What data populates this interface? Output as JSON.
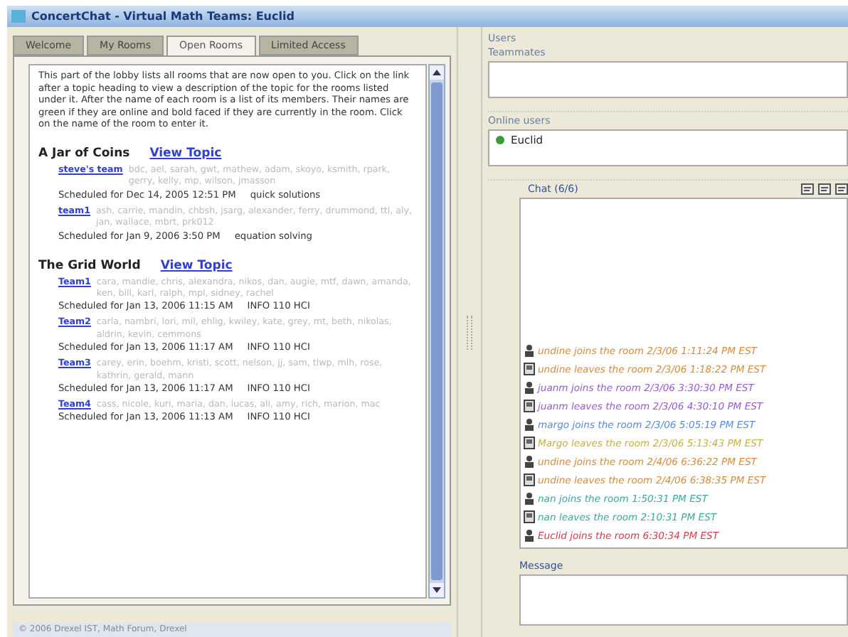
{
  "window": {
    "title": "ConcertChat - Virtual Math Teams: Euclid"
  },
  "tabs": [
    {
      "label": "Welcome",
      "selected": false
    },
    {
      "label": "My Rooms",
      "selected": false
    },
    {
      "label": "Open Rooms",
      "selected": true
    },
    {
      "label": "Limited Access",
      "selected": false
    }
  ],
  "intro": "This part of the lobby lists all rooms that are now open to you. Click on the link after a topic heading to view a description of the topic for the rooms listed under it. After the name of each room is a list of its members. Their names are green if they are online and bold faced if they are currently in the room. Click on the name of the room to enter it.",
  "topics": [
    {
      "title": "A Jar of Coins",
      "link": "View Topic",
      "rooms": [
        {
          "name": "steve's team",
          "members": "bdc, ael, sarah, gwt, mathew, adam, skoyo, ksmith, rpark, gerry, kelly, mp, wilson, jmasson",
          "schedule": "Scheduled for Dec 14, 2005 12:51 PM",
          "topic": "quick solutions"
        },
        {
          "name": "team1",
          "members": "ash, carrie, mandin, chbsh, jsarg, alexander, ferry, drummond, ttl, aly, jan, wallace, mbrt, prk012",
          "schedule": "Scheduled for Jan 9, 2006 3:50 PM",
          "topic": "equation solving"
        }
      ]
    },
    {
      "title": "The Grid World",
      "link": "View Topic",
      "rooms": [
        {
          "name": "Team1",
          "members": "cara, mandie, chris, alexandra, nikos, dan, augie, mtf, dawn, amanda, ken, bill, karl, ralph, mpl, sidney, rachel",
          "schedule": "Scheduled for Jan 13, 2006 11:15 AM",
          "topic": "INFO 110 HCI"
        },
        {
          "name": "Team2",
          "members": "carla, nambri, lori, mil, ehlig, kwiley, kate, grey, mt, beth, nikolas, aldrin, kevin, cemmons",
          "schedule": "Scheduled for Jan 13, 2006 11:17 AM",
          "topic": "INFO 110 HCI"
        },
        {
          "name": "Team3",
          "members": "carey, erin, boehm, kristi, scott, nelson, jj, sam, tlwp, mlh, rose, kathrin, gerald, mann",
          "schedule": "Scheduled for Jan 13, 2006 11:17 AM",
          "topic": "INFO 110 HCI"
        },
        {
          "name": "Team4",
          "members": "cass, nicole, kuri, maria, dan, lucas, ali, amy, rich, marion, mac",
          "schedule": "Scheduled for Jan 13, 2006 11:13 AM",
          "topic": "INFO 110 HCI"
        }
      ]
    }
  ],
  "status_bar": "© 2006 Drexel IST, Math Forum, Drexel",
  "users": {
    "title": "Users",
    "teammates_label": "Teammates",
    "online_label": "Online users",
    "online": [
      {
        "name": "Euclid"
      }
    ]
  },
  "chat": {
    "title": "Chat (6/6)",
    "messages": [
      {
        "kind": "join",
        "text": "undine joins the room 2/3/06 1:11:24 PM EST",
        "color": "#d98a3a"
      },
      {
        "kind": "leave",
        "text": "undine leaves the room 2/3/06 1:18:22 PM EST",
        "color": "#d98a3a"
      },
      {
        "kind": "join",
        "text": "juanm joins the room 2/3/06 3:30:30 PM EST",
        "color": "#9a5ad0"
      },
      {
        "kind": "leave",
        "text": "juanm leaves the room 2/3/06 4:30:10 PM EST",
        "color": "#9a5ad0"
      },
      {
        "kind": "join",
        "text": "margo joins the room 2/3/06 5:05:19 PM EST",
        "color": "#5a8ad8"
      },
      {
        "kind": "leave",
        "text": "Margo leaves the room 2/3/06 5:13:43 PM EST",
        "color": "#c8b040"
      },
      {
        "kind": "join",
        "text": "undine joins the room 2/4/06 6:36:22 PM EST",
        "color": "#d98a3a"
      },
      {
        "kind": "leave",
        "text": "undine leaves the room 2/4/06 6:38:35 PM EST",
        "color": "#d98a3a"
      },
      {
        "kind": "join",
        "text": "nan joins the room 1:50:31 PM EST",
        "color": "#3aaa9a"
      },
      {
        "kind": "leave",
        "text": "nan leaves the room 2:10:31 PM EST",
        "color": "#3aaa9a"
      },
      {
        "kind": "join",
        "text": "Euclid joins the room 6:30:34 PM EST",
        "color": "#d83a4a"
      }
    ]
  },
  "message": {
    "label": "Message"
  }
}
